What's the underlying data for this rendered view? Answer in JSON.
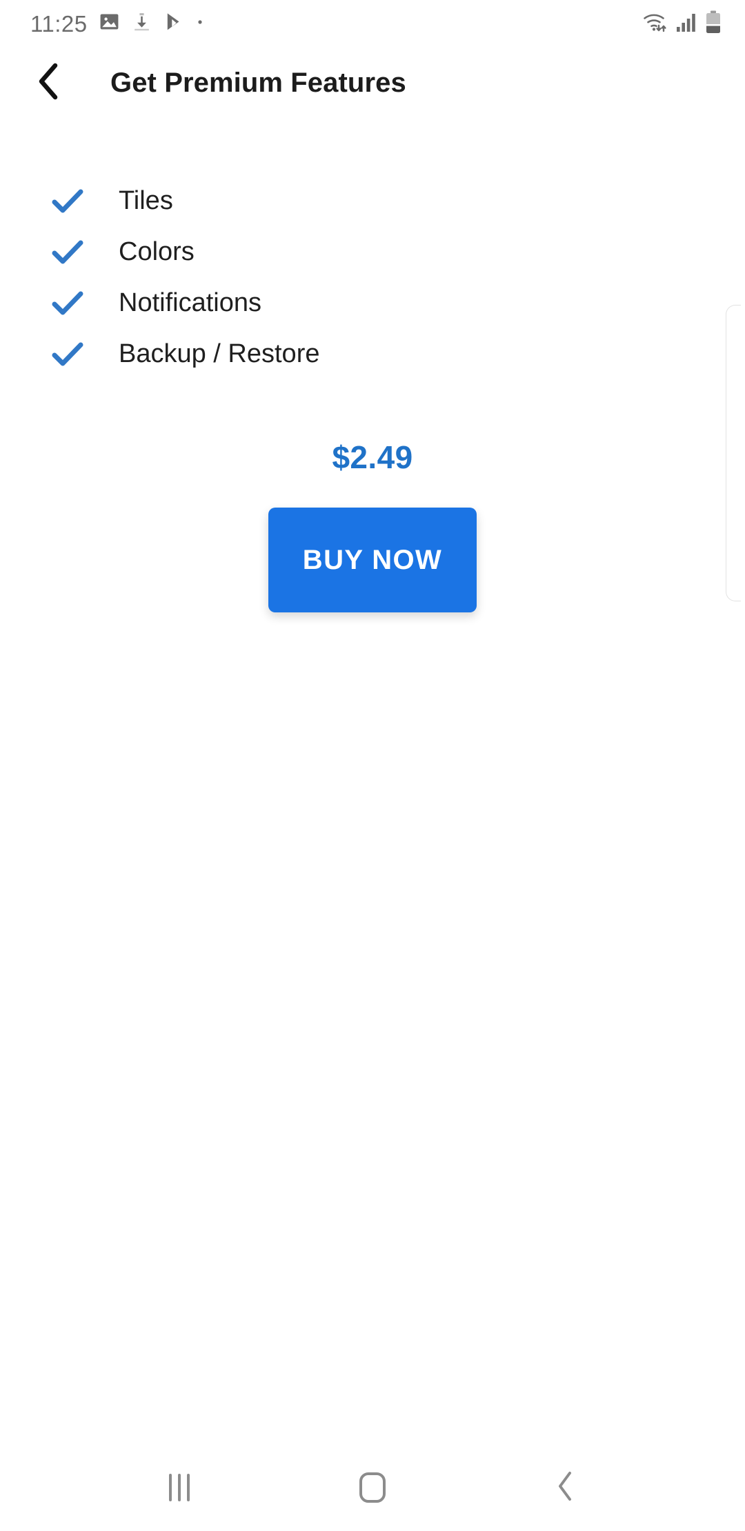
{
  "status_bar": {
    "clock": "11:25",
    "left_icons": [
      "image-icon",
      "download-icon",
      "play-store-icon",
      "dot-icon"
    ],
    "right_icons": [
      "wifi-icon",
      "signal-icon",
      "battery-icon"
    ],
    "battery_level_percent": 40,
    "signal_bars": 4,
    "icon_color": "#6b6b6b"
  },
  "app_bar": {
    "back_icon": "chevron-left-icon",
    "title": "Get Premium Features"
  },
  "features": {
    "check_icon": "check-icon",
    "check_color": "#3178c6",
    "items": [
      {
        "label": "Tiles"
      },
      {
        "label": "Colors"
      },
      {
        "label": "Notifications"
      },
      {
        "label": "Backup / Restore"
      }
    ]
  },
  "purchase": {
    "price": "$2.49",
    "price_color": "#1f72c8",
    "buy_label": "BUY NOW",
    "buy_button_color": "#1b74e4",
    "buy_label_color": "#ffffff"
  },
  "nav_bar": {
    "recents_label": "recents-icon",
    "home_label": "home-icon",
    "back_label": "back-icon",
    "icon_color": "#8c8c8c"
  }
}
